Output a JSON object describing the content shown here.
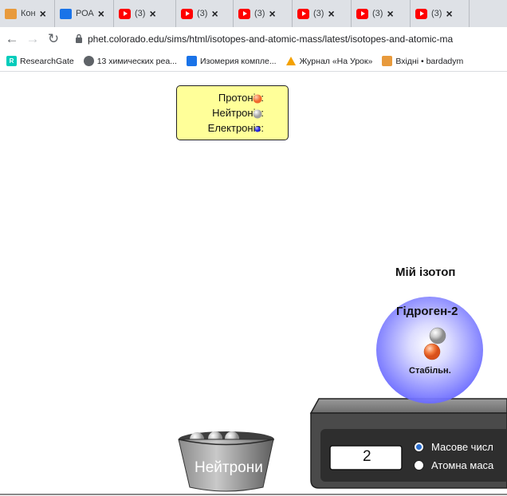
{
  "browser": {
    "tabs": [
      {
        "title": "Кон",
        "icon": "shopping-bag-icon"
      },
      {
        "title": "РОА",
        "icon": "document-icon"
      },
      {
        "title": "(3)",
        "icon": "youtube-icon"
      },
      {
        "title": "(3)",
        "icon": "youtube-icon"
      },
      {
        "title": "(3)",
        "icon": "youtube-icon"
      },
      {
        "title": "(3)",
        "icon": "youtube-icon"
      },
      {
        "title": "(3)",
        "icon": "youtube-icon"
      },
      {
        "title": "(3)",
        "icon": "youtube-icon"
      }
    ],
    "url": "phet.colorado.edu/sims/html/isotopes-and-atomic-mass/latest/isotopes-and-atomic-ma",
    "bookmarks": [
      {
        "label": "ResearchGate",
        "icon": "researchgate-icon",
        "color": "#00ccbb"
      },
      {
        "label": "13 химических реа...",
        "icon": "globe-icon",
        "color": "#5f6368"
      },
      {
        "label": "Изомерия компле...",
        "icon": "flask-icon",
        "color": "#1a73e8"
      },
      {
        "label": "Журнал «На Урок»",
        "icon": "warning-icon",
        "color": "#f4a100"
      },
      {
        "label": "Вхідні • bardadym",
        "icon": "shopping-bag-icon",
        "color": "#e89a3c"
      }
    ]
  },
  "legend": {
    "protons_label": "Протонів:",
    "neutrons_label": "Нейтронів:",
    "electrons_label": "Електронів:"
  },
  "colors": {
    "proton": "#f0682c",
    "neutron": "#b8b8b8",
    "electron": "#4444ff",
    "legend_bg": "#ffff99",
    "atom_cloud": "#7b7bff",
    "scale_body": "#4a4a4a"
  },
  "isotope": {
    "section_title": "Мій ізотоп",
    "element_name": "Гідроген-2",
    "stability": "Стабільн.",
    "protons": 1,
    "neutrons": 1
  },
  "scale": {
    "readout": "2",
    "option_mass_number": "Масове числ",
    "option_atomic_mass": "Атомна маса",
    "selected": "mass_number"
  },
  "bucket": {
    "label": "Нейтрони"
  }
}
